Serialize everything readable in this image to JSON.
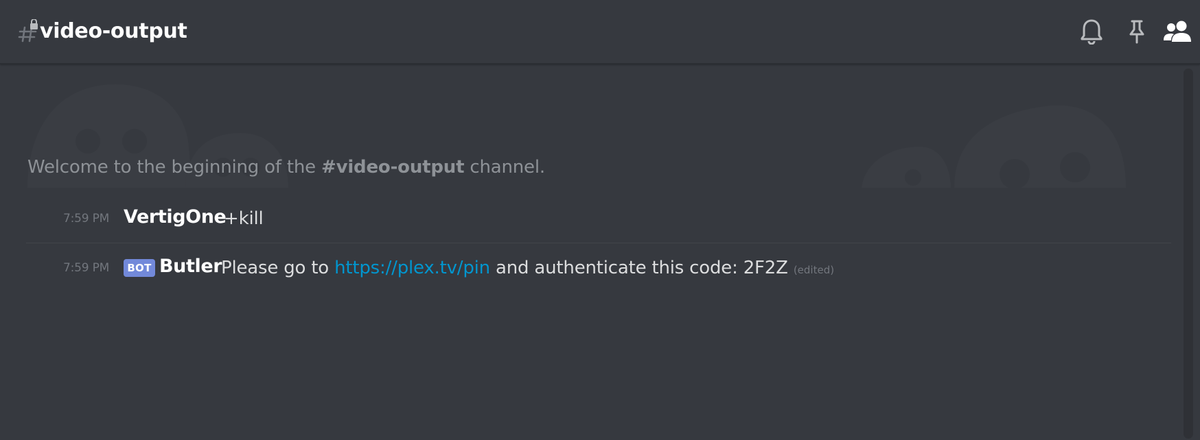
{
  "header": {
    "channel_name": "video-output",
    "icons": [
      "hash-lock-icon",
      "bell-icon",
      "pin-icon",
      "members-icon"
    ]
  },
  "welcome": {
    "prefix": "Welcome to the beginning of the ",
    "channel": "#video-output",
    "suffix": " channel."
  },
  "messages": [
    {
      "timestamp": "7:59 PM",
      "author": "VertigOne",
      "text": "+kill"
    },
    {
      "timestamp": "7:59 PM",
      "bot_tag": "BOT",
      "author": "Butler",
      "text_before": "Please go to ",
      "link": "https://plex.tv/pin",
      "text_after": " and authenticate this code: 2F2Z ",
      "edited": "(edited)"
    }
  ],
  "colors": {
    "background": "#36393f",
    "link": "#0096cf",
    "bot_tag": "#7289da",
    "muted": "#72767d"
  }
}
